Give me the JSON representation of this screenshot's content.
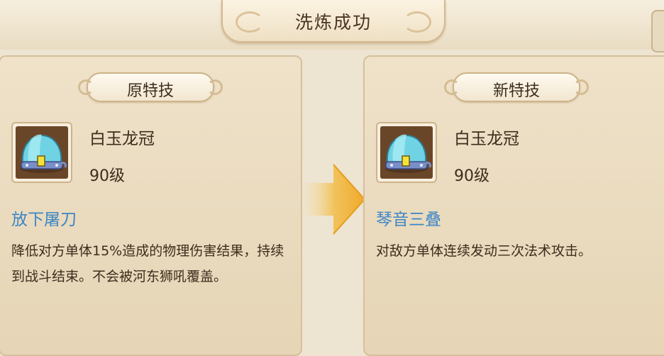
{
  "dialog": {
    "title": "洗炼成功"
  },
  "original": {
    "label": "原特技",
    "item_name": "白玉龙冠",
    "item_level": "90级",
    "skill_name": "放下屠刀",
    "skill_desc": "降低对方单体15%造成的物理伤害结果，持续到战斗结束。不会被河东狮吼覆盖。"
  },
  "new": {
    "label": "新特技",
    "item_name": "白玉龙冠",
    "item_level": "90级",
    "skill_name": "琴音三叠",
    "skill_desc": "对敌方单体连续发动三次法术攻击。"
  },
  "icons": {
    "item": "jade-dragon-crown-icon",
    "arrow": "right-arrow-icon"
  },
  "colors": {
    "skill_name": "#3c86c6",
    "arrow": "#f0b43a"
  }
}
